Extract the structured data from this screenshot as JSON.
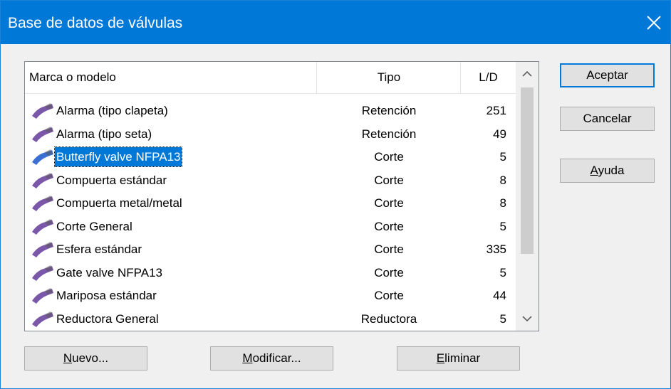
{
  "window": {
    "title": "Base de datos de válvulas",
    "close_glyph": "✕"
  },
  "list": {
    "columns": [
      "Marca o modelo",
      "Tipo",
      "L/D"
    ],
    "rows": [
      {
        "name": "Alarma (tipo clapeta)",
        "tipo": "Retención",
        "ld": "251"
      },
      {
        "name": "Alarma (tipo seta)",
        "tipo": "Retención",
        "ld": "49"
      },
      {
        "name": "Butterfly valve NFPA13",
        "tipo": "Corte",
        "ld": "5",
        "selected": true
      },
      {
        "name": "Compuerta estándar",
        "tipo": "Corte",
        "ld": "8"
      },
      {
        "name": "Compuerta metal/metal",
        "tipo": "Corte",
        "ld": "8"
      },
      {
        "name": "Corte General",
        "tipo": "Corte",
        "ld": "5"
      },
      {
        "name": "Esfera estándar",
        "tipo": "Corte",
        "ld": "335"
      },
      {
        "name": "Gate valve NFPA13",
        "tipo": "Corte",
        "ld": "5"
      },
      {
        "name": "Mariposa estándar",
        "tipo": "Corte",
        "ld": "44"
      },
      {
        "name": "Reductora General",
        "tipo": "Reductora",
        "ld": "5"
      }
    ],
    "icon": "valve-icon"
  },
  "buttons": {
    "aceptar": "Aceptar",
    "cancelar": "Cancelar",
    "ayuda": {
      "mnemonic": "A",
      "rest": "yuda"
    },
    "nuevo": {
      "mnemonic": "N",
      "rest": "uevo..."
    },
    "modificar": {
      "mnemonic": "M",
      "rest": "odificar..."
    },
    "eliminar": {
      "mnemonic": "E",
      "rest": "liminar"
    }
  },
  "colors": {
    "titlebar": "#0078d7",
    "selection": "#0078d7",
    "valve_purple": "#7a57a8",
    "valve_blue": "#3b6fd1"
  }
}
